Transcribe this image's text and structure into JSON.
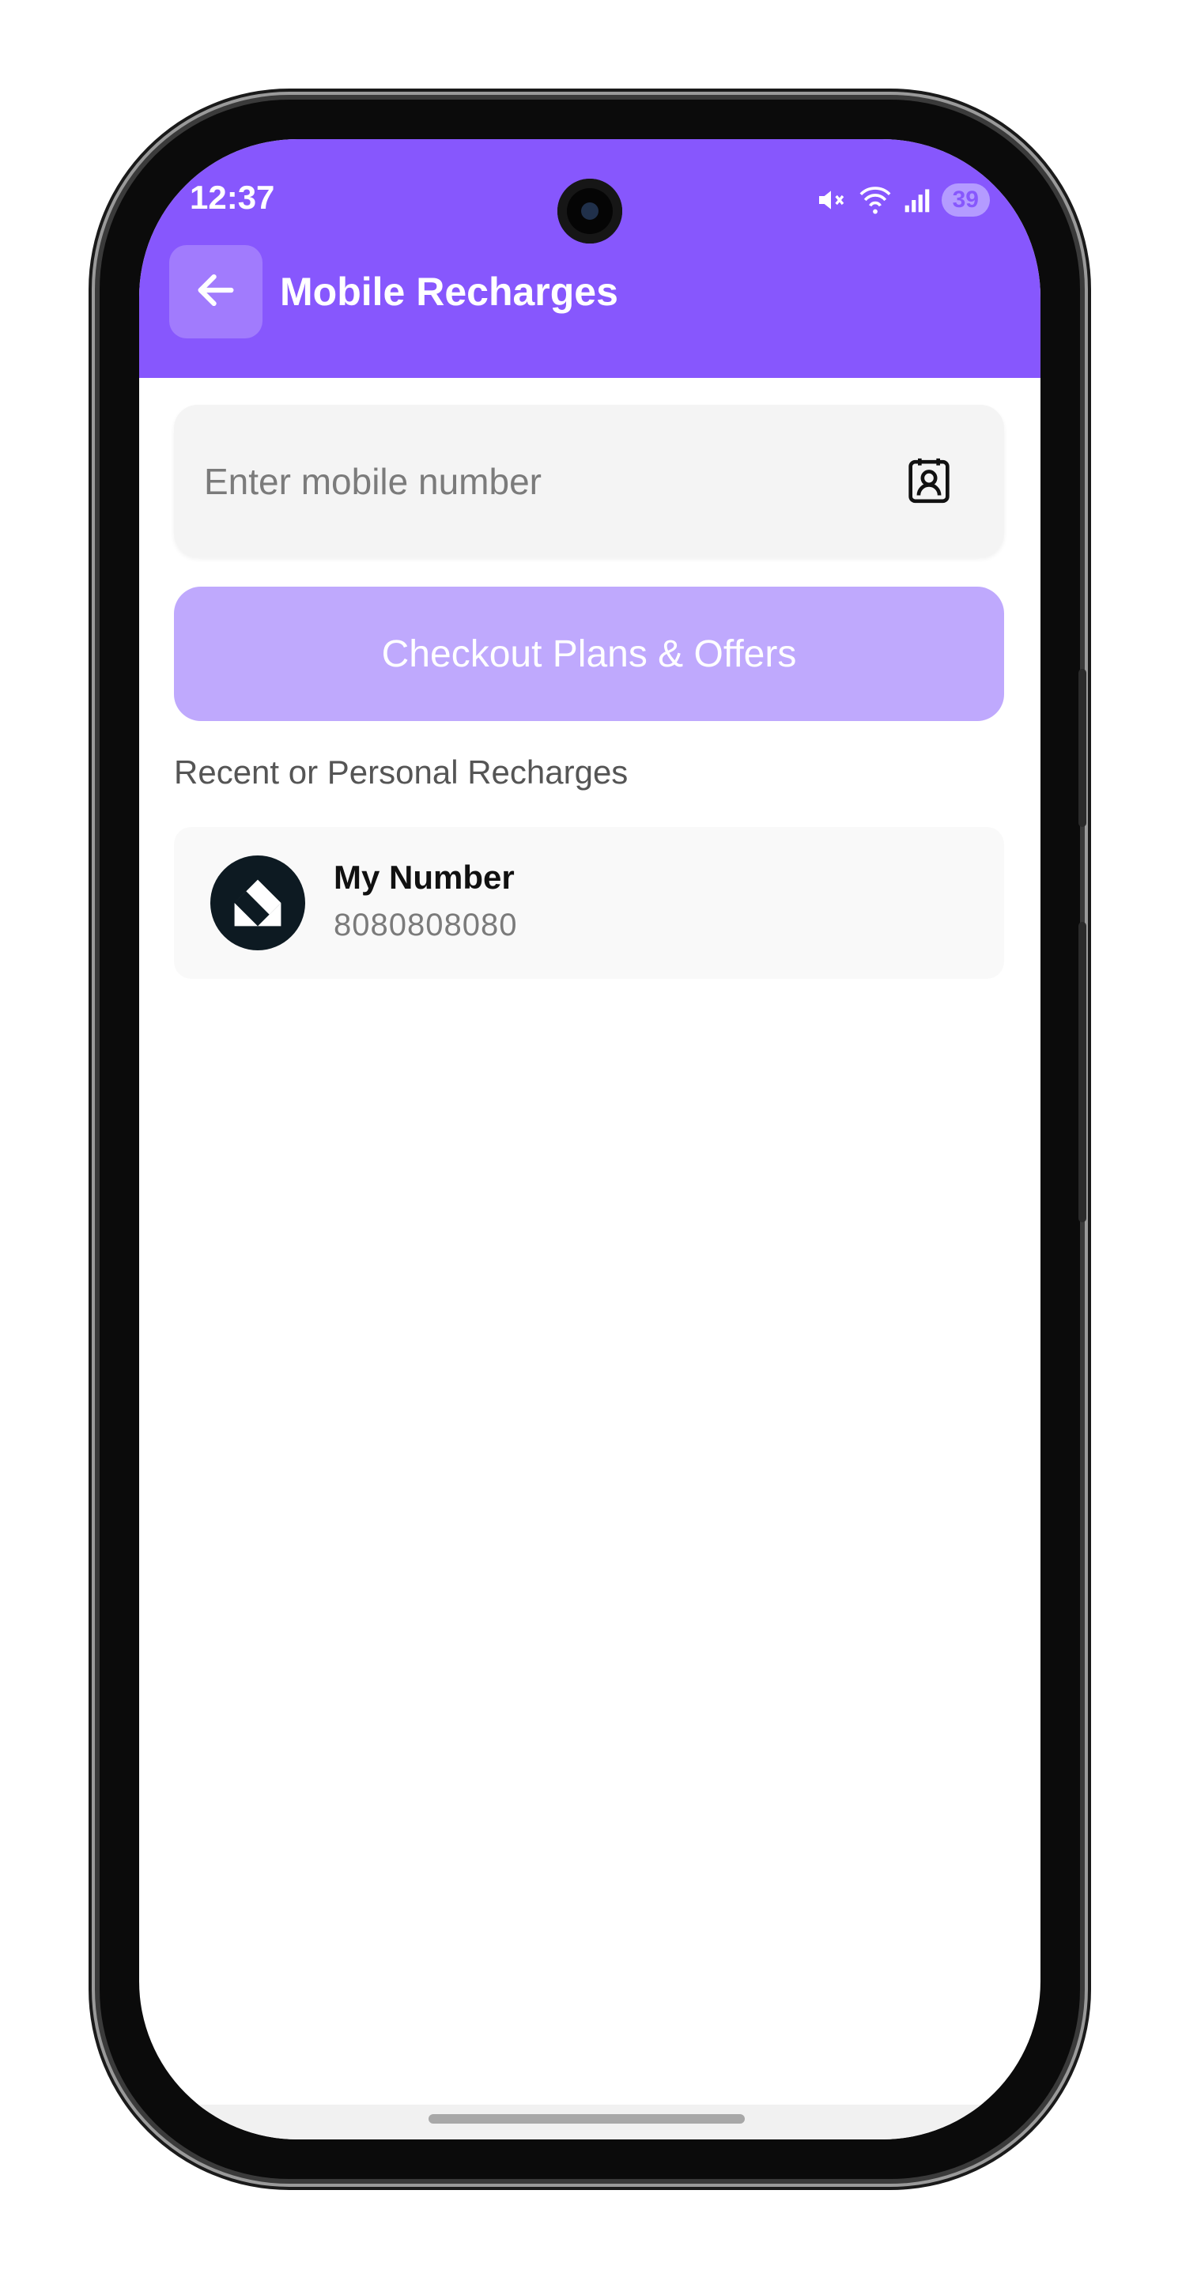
{
  "status_bar": {
    "time": "12:37",
    "battery": "39",
    "icons": [
      "mute-icon",
      "wifi-icon",
      "signal-icon",
      "battery-icon"
    ]
  },
  "header": {
    "title": "Mobile Recharges",
    "back_icon": "arrow-left-icon"
  },
  "mobile_input": {
    "placeholder": "Enter mobile number",
    "value": "",
    "contact_icon": "contact-book-icon"
  },
  "cta": {
    "label": "Checkout Plans & Offers"
  },
  "recent": {
    "section_label": "Recent or Personal Recharges",
    "items": [
      {
        "name": "My Number",
        "number": "8080808080",
        "avatar_icon": "brand-logo-icon"
      }
    ]
  },
  "colors": {
    "primary": "#8757fd",
    "cta_disabled": "#bfa9fd",
    "input_bg": "#f4f4f4"
  }
}
